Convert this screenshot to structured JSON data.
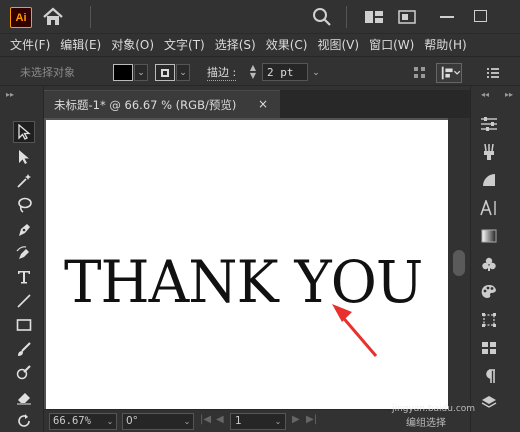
{
  "app": {
    "logo_text": "Ai"
  },
  "menu": [
    "文件(F)",
    "编辑(E)",
    "对象(O)",
    "文字(T)",
    "选择(S)",
    "效果(C)",
    "视图(V)",
    "窗口(W)",
    "帮助(H)"
  ],
  "controlbar": {
    "selection_status": "未选择对象",
    "stroke_label": "描边 :",
    "stroke_value": "2 pt"
  },
  "document": {
    "tab_title": "未标题-1* @ 66.67 % (RGB/预览)",
    "close_glyph": "×"
  },
  "canvas": {
    "text": "THANK YOU"
  },
  "statusbar": {
    "zoom": "66.67%",
    "rotation": "0°",
    "page": "1",
    "status_text": "编组选择"
  },
  "watermark": "jingyan.baidu.com",
  "colors": {
    "accent_ai": "#ff9a00",
    "arrow_red": "#e8312f"
  },
  "icons": {
    "titlebar": [
      "home-icon",
      "search-icon",
      "arrange-icon",
      "window-icon",
      "minimize-icon",
      "maximize-icon"
    ],
    "tools": [
      "selection-tool",
      "direct-selection-tool",
      "magic-wand-tool",
      "lasso-tool",
      "pen-tool",
      "curvature-tool",
      "type-tool",
      "line-tool",
      "rectangle-tool",
      "paintbrush-tool",
      "shaper-tool",
      "eraser-tool",
      "rotate-tool"
    ],
    "panels": [
      "properties-icon",
      "brushes-icon",
      "transparency-icon",
      "character-icon",
      "gradient-icon",
      "symbols-icon",
      "color-icon",
      "transform-icon",
      "align-icon",
      "paragraph-icon"
    ]
  }
}
